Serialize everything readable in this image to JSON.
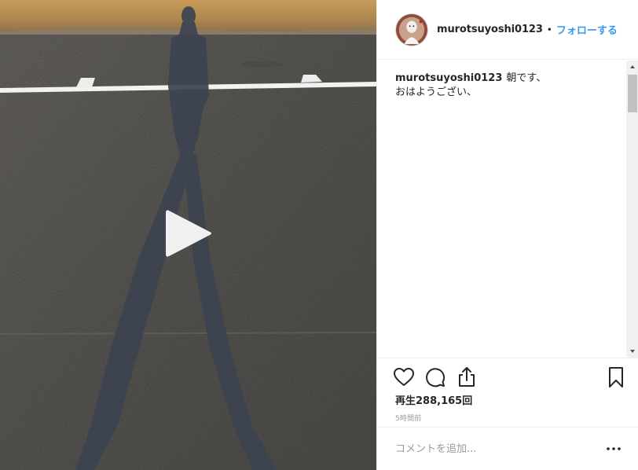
{
  "media": {
    "type": "video",
    "play_icon": "play-icon"
  },
  "header": {
    "username": "murotsuyoshi0123",
    "separator": "•",
    "follow_label": "フォローする",
    "avatar_icon": "avatar"
  },
  "caption": {
    "username": "murotsuyoshi0123",
    "text_line1": "朝です、",
    "text_line2": "おはようござい、"
  },
  "actions": {
    "icons": [
      "heart-icon",
      "comment-icon",
      "share-icon",
      "bookmark-icon"
    ],
    "plays_label": "再生288,165回",
    "timestamp": "5時間前"
  },
  "comment_box": {
    "placeholder": "コメントを追加...",
    "more_icon": "more-icon"
  },
  "colors": {
    "link": "#3897f0",
    "text": "#262626",
    "muted": "#999999",
    "border": "#efefef"
  }
}
